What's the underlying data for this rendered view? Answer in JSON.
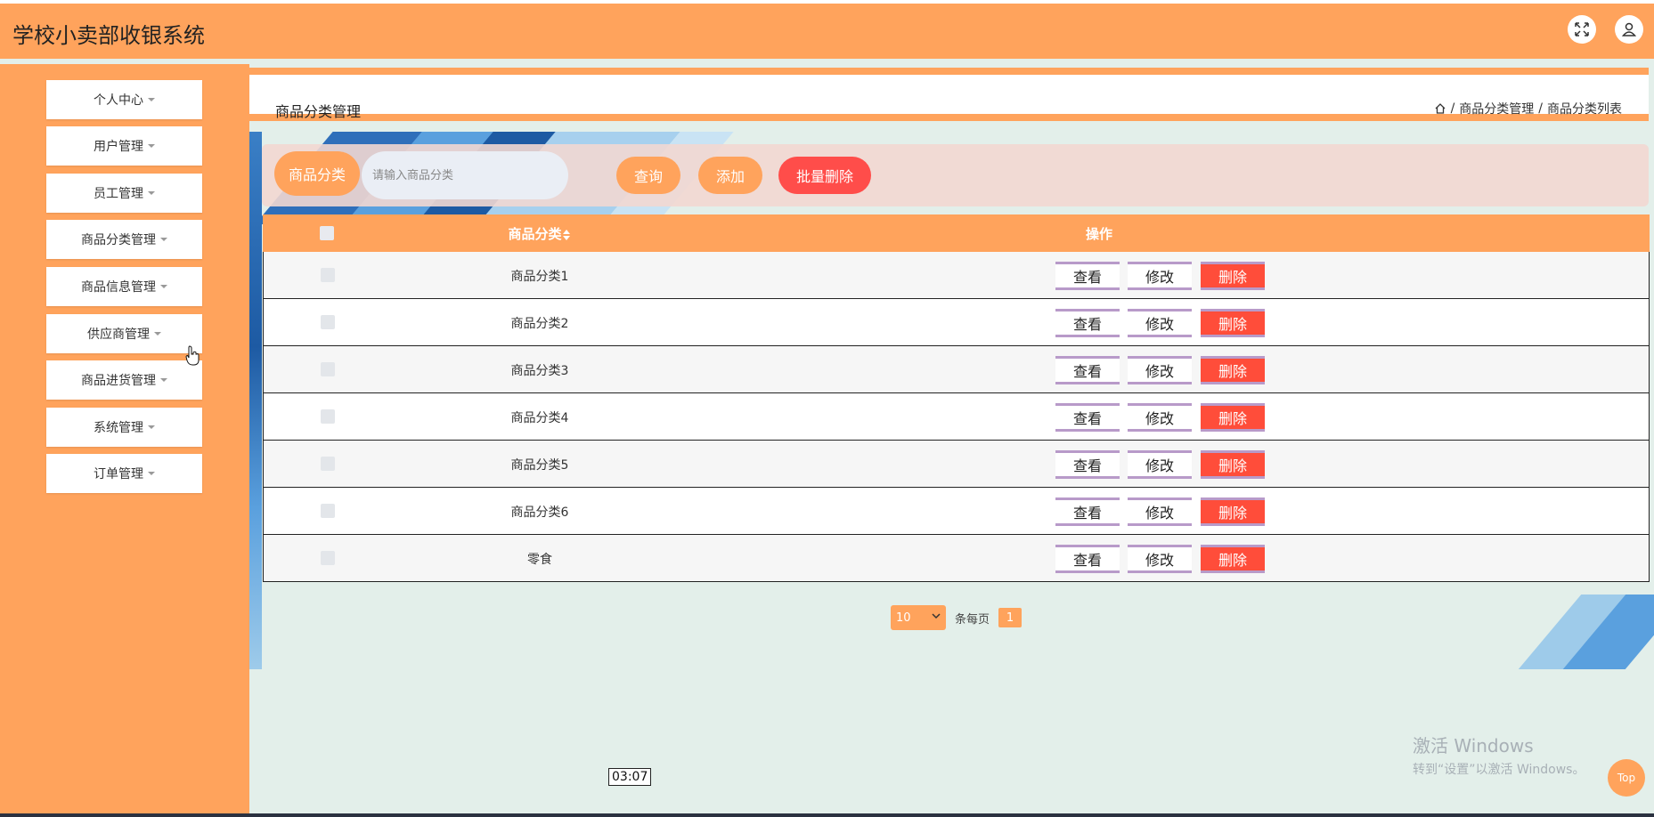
{
  "header": {
    "title": "学校小卖部收银系统",
    "fullscreen_icon": "fullscreen-icon",
    "user_icon": "user-icon"
  },
  "sidebar": {
    "items": [
      {
        "label": "个人中心"
      },
      {
        "label": "用户管理"
      },
      {
        "label": "员工管理"
      },
      {
        "label": "商品分类管理"
      },
      {
        "label": "商品信息管理"
      },
      {
        "label": "供应商管理"
      },
      {
        "label": "商品进货管理"
      },
      {
        "label": "系统管理"
      },
      {
        "label": "订单管理"
      }
    ]
  },
  "page": {
    "title": "商品分类管理",
    "breadcrumb": [
      "商品分类管理",
      "商品分类列表"
    ],
    "breadcrumb_sep": "/"
  },
  "search": {
    "label": "商品分类",
    "placeholder": "请输入商品分类",
    "query_button": "查询",
    "add_button": "添加",
    "batch_delete_button": "批量删除"
  },
  "table": {
    "headers": {
      "category": "商品分类",
      "actions": "操作"
    },
    "rows": [
      {
        "category": "商品分类1"
      },
      {
        "category": "商品分类2"
      },
      {
        "category": "商品分类3"
      },
      {
        "category": "商品分类4"
      },
      {
        "category": "商品分类5"
      },
      {
        "category": "商品分类6"
      },
      {
        "category": "零食"
      }
    ],
    "actions": {
      "view": "查看",
      "edit": "修改",
      "delete": "删除"
    }
  },
  "pagination": {
    "page_size": "10",
    "per_page_label": "条每页",
    "current_page": "1"
  },
  "watermark": {
    "line1": "激活 Windows",
    "line2": "转到“设置”以激活 Windows。"
  },
  "timer": "03:07",
  "top_button": "Top",
  "colors": {
    "accent": "#ffa35c",
    "danger": "#ff4d3a",
    "background": "#e3efea"
  }
}
